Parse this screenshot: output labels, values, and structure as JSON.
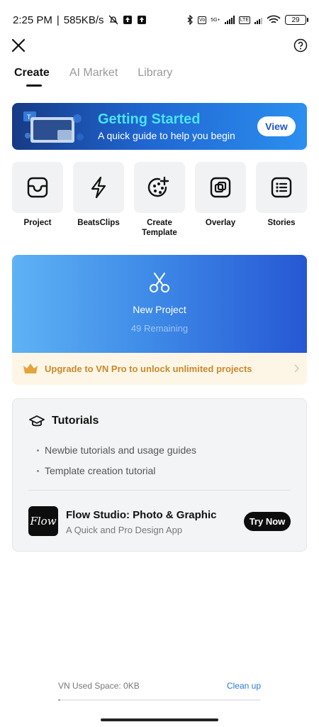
{
  "status_bar": {
    "time": "2:25 PM",
    "speed": "585KB/s",
    "battery": "29",
    "net1": "5G+",
    "tag_vo": "Vo",
    "tag_lte": "LTE"
  },
  "tabs": [
    {
      "label": "Create",
      "active": true
    },
    {
      "label": "AI Market",
      "active": false
    },
    {
      "label": "Library",
      "active": false
    }
  ],
  "banner": {
    "title": "Getting Started",
    "subtitle": "A quick guide to help you begin",
    "button": "View"
  },
  "tools": [
    {
      "label": "Project",
      "icon": "project-icon"
    },
    {
      "label": "BeatsClips",
      "icon": "lightning-icon"
    },
    {
      "label": "Create\nTemplate",
      "icon": "template-icon"
    },
    {
      "label": "Overlay",
      "icon": "overlay-icon"
    },
    {
      "label": "Stories",
      "icon": "list-icon"
    }
  ],
  "new_project": {
    "title": "New Project",
    "remaining": "49 Remaining"
  },
  "upgrade": {
    "text": "Upgrade to VN Pro to unlock unlimited projects"
  },
  "tutorials": {
    "title": "Tutorials",
    "items": [
      "Newbie tutorials and usage guides",
      "Template creation tutorial"
    ],
    "promo": {
      "logo_text": "Flow",
      "title": "Flow Studio: Photo & Graphic",
      "subtitle": "A Quick and Pro Design App",
      "button": "Try Now"
    }
  },
  "footer": {
    "space_label": "VN Used Space: 0KB",
    "cleanup": "Clean up",
    "used_fraction": 0.01
  },
  "colors": {
    "accent_cyan": "#49e3f7",
    "upgrade_gold": "#c68a2c",
    "link_blue": "#2a78d6"
  }
}
